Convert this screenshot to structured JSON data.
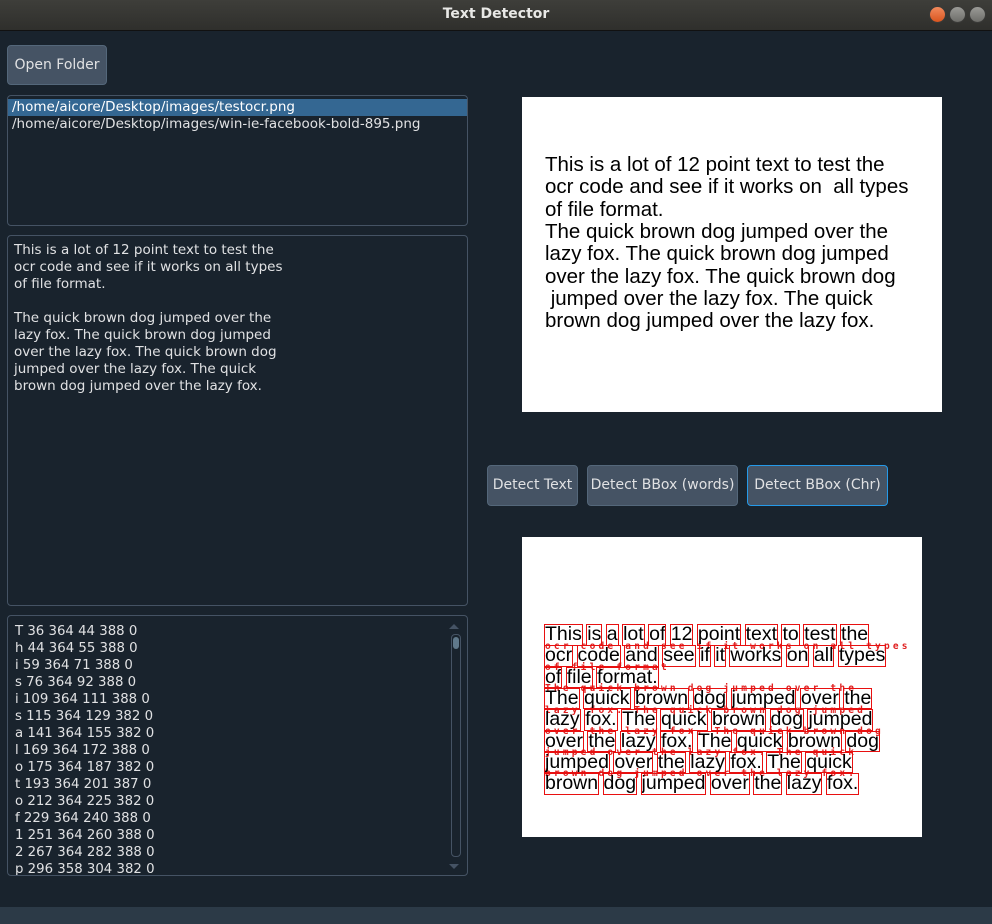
{
  "window": {
    "title": "Text Detector"
  },
  "buttons": {
    "open_folder": "Open Folder",
    "detect_text": "Detect Text",
    "detect_bbox_words": "Detect BBox (words)",
    "detect_bbox_chr": "Detect BBox (Chr)"
  },
  "file_list": {
    "items": [
      {
        "path": "/home/aicore/Desktop/images/testocr.png",
        "selected": true
      },
      {
        "path": "/home/aicore/Desktop/images/win-ie-facebook-bold-895.png",
        "selected": false
      }
    ]
  },
  "ocr_output": {
    "lines": [
      "This is a lot of 12 point text to test the",
      "ocr code and see if it works on all types",
      "of file format.",
      "",
      "The quick brown dog jumped over the",
      "lazy fox. The quick brown dog jumped",
      "over the lazy fox. The quick brown dog",
      "jumped over the lazy fox. The quick",
      "brown dog jumped over the lazy fox."
    ]
  },
  "bbox_output": {
    "lines": [
      "T 36 364 44 388 0",
      "h 44 364 55 388 0",
      "i 59 364 71 388 0",
      "s 76 364 92 388 0",
      "i 109 364 111 388 0",
      "s 115 364 129 382 0",
      "a 141 364 155 382 0",
      "l 169 364 172 388 0",
      "o 175 364 187 382 0",
      "t 193 364 201 387 0",
      "o 212 364 225 382 0",
      "f 229 364 240 388 0",
      "1 251 364 260 388 0",
      "2 267 364 282 388 0",
      "p 296 358 304 382 0"
    ]
  },
  "preview_image": {
    "lines": [
      "This is a lot of 12 point text to test the",
      "ocr code and see if it works on  all types",
      "of file format.",
      "The quick brown dog jumped over the",
      "lazy fox. The quick brown dog jumped",
      "over the lazy fox. The quick brown dog",
      " jumped over the lazy fox. The quick",
      "brown dog jumped over the lazy fox."
    ]
  },
  "result_image": {
    "lines": [
      "This is a lot of 12 point text to test the",
      "ocr code and see if it works on all types",
      "of file format.",
      "The quick brown dog jumped over the",
      "lazy fox. The quick brown dog jumped",
      "over the lazy fox. The quick brown dog",
      "jumped over the lazy fox. The quick",
      "brown dog jumped over the lazy fox."
    ],
    "overlay_rows": [
      "ocr code and see if it works on all types",
      "of file format",
      "The quick brown dog jumped over the",
      "lazy fox. The quick brown dog jumped",
      "over the lazy fox. The quick brown dog",
      "jumped over the lazy fox. The quick",
      "brown dog jumped over the lazy fox."
    ]
  },
  "colors": {
    "background": "#19232d",
    "border": "#455364",
    "selection": "#346792",
    "focus_border": "#259ae9",
    "bbox": "#e81010"
  }
}
